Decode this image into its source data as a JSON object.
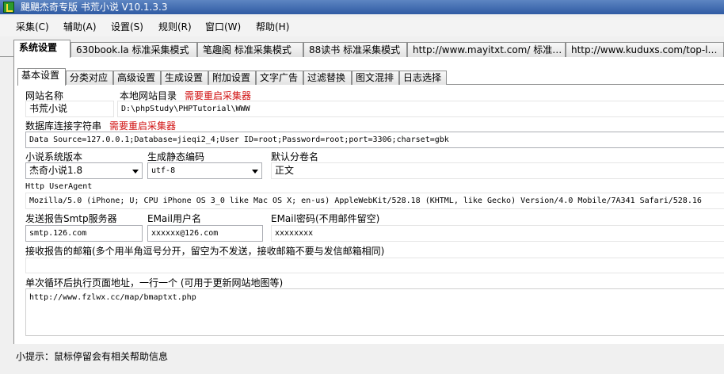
{
  "window": {
    "title": "颶颶杰奇专版 书荒小说 V10.1.3.3",
    "icon": "app-icon"
  },
  "menu": [
    "采集(C)",
    "辅助(A)",
    "设置(S)",
    "规则(R)",
    "窗口(W)",
    "帮助(H)"
  ],
  "tabs": [
    "系统设置",
    "630book.la 标准采集模式",
    "笔趣阁 标准采集模式",
    "88读书 标准采集模式",
    "http://www.mayitxt.com/ 标准…",
    "http://www.kuduxs.com/top-l…"
  ],
  "subtabs": [
    "基本设置",
    "分类对应",
    "高级设置",
    "生成设置",
    "附加设置",
    "文字广告",
    "过滤替换",
    "图文混排",
    "日志选择"
  ],
  "form": {
    "site_name_label": "网站名称",
    "site_name_value": "书荒小说",
    "local_dir_label": "本地网站目录",
    "restart_warning": "需要重启采集器",
    "local_dir_value": "D:\\phpStudy\\PHPTutorial\\WWW",
    "db_label": "数据库连接字符串",
    "db_value": "Data Source=127.0.0.1;Database=jieqi2_4;User ID=root;Password=root;port=3306;charset=gbk",
    "version_label": "小说系统版本",
    "version_value": "杰奇小说1.8",
    "encoding_label": "生成静态编码",
    "encoding_value": "utf-8",
    "volume_label": "默认分卷名",
    "volume_value": "正文",
    "ua_label": "Http UserAgent",
    "ua_value": "Mozilla/5.0 (iPhone; U; CPU iPhone OS 3_0 like Mac OS X; en-us) AppleWebKit/528.18 (KHTML, like Gecko) Version/4.0 Mobile/7A341 Safari/528.16",
    "smtp_label": "发送报告Smtp服务器",
    "smtp_value": "smtp.126.com",
    "email_user_label": "EMail用户名",
    "email_user_value": "xxxxxx@126.com",
    "email_pwd_label": "EMail密码(不用邮件留空)",
    "email_pwd_value": "xxxxxxxx",
    "report_label": "接收报告的邮箱(多个用半角逗号分开，留空为不发送，接收邮箱不要与发信邮箱相同)",
    "report_value": "",
    "loop_url_label": "单次循环后执行页面地址，一行一个 (可用于更新网站地图等)",
    "loop_url_value": "http://www.fzlwx.cc/map/bmaptxt.php"
  },
  "hint": "小提示：鼠标停留会有相关帮助信息"
}
